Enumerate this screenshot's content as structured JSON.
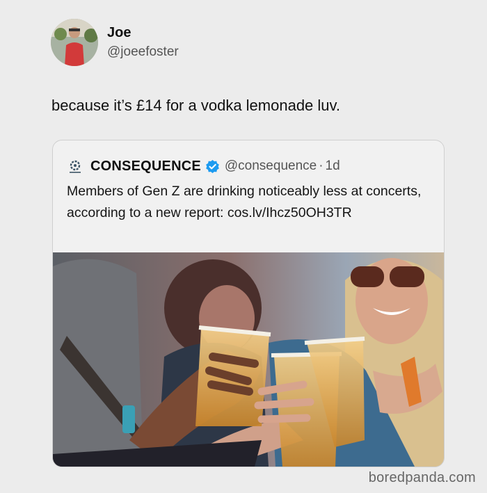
{
  "tweet": {
    "author_name": "Joe",
    "author_handle": "@joeefoster",
    "text": "because it’s £14 for a vodka lemonade luv."
  },
  "quoted_tweet": {
    "account_name": "CONSEQUENCE",
    "verified": true,
    "account_handle": "@consequence",
    "separator": "·",
    "time": "1d",
    "text": "Members of Gen Z are drinking noticeably less at concerts, according to a new report: cos.lv/Ihcz50OH3TR",
    "media": "photo of people toasting with plastic cups of beer at a festival"
  },
  "watermark": "boredpanda.com",
  "colors": {
    "background": "#ececec",
    "verified_badge": "#1d9bf0",
    "handle_text": "#555555"
  },
  "icons": [
    "avatar",
    "consequence-logo-icon",
    "verified-badge-icon"
  ]
}
